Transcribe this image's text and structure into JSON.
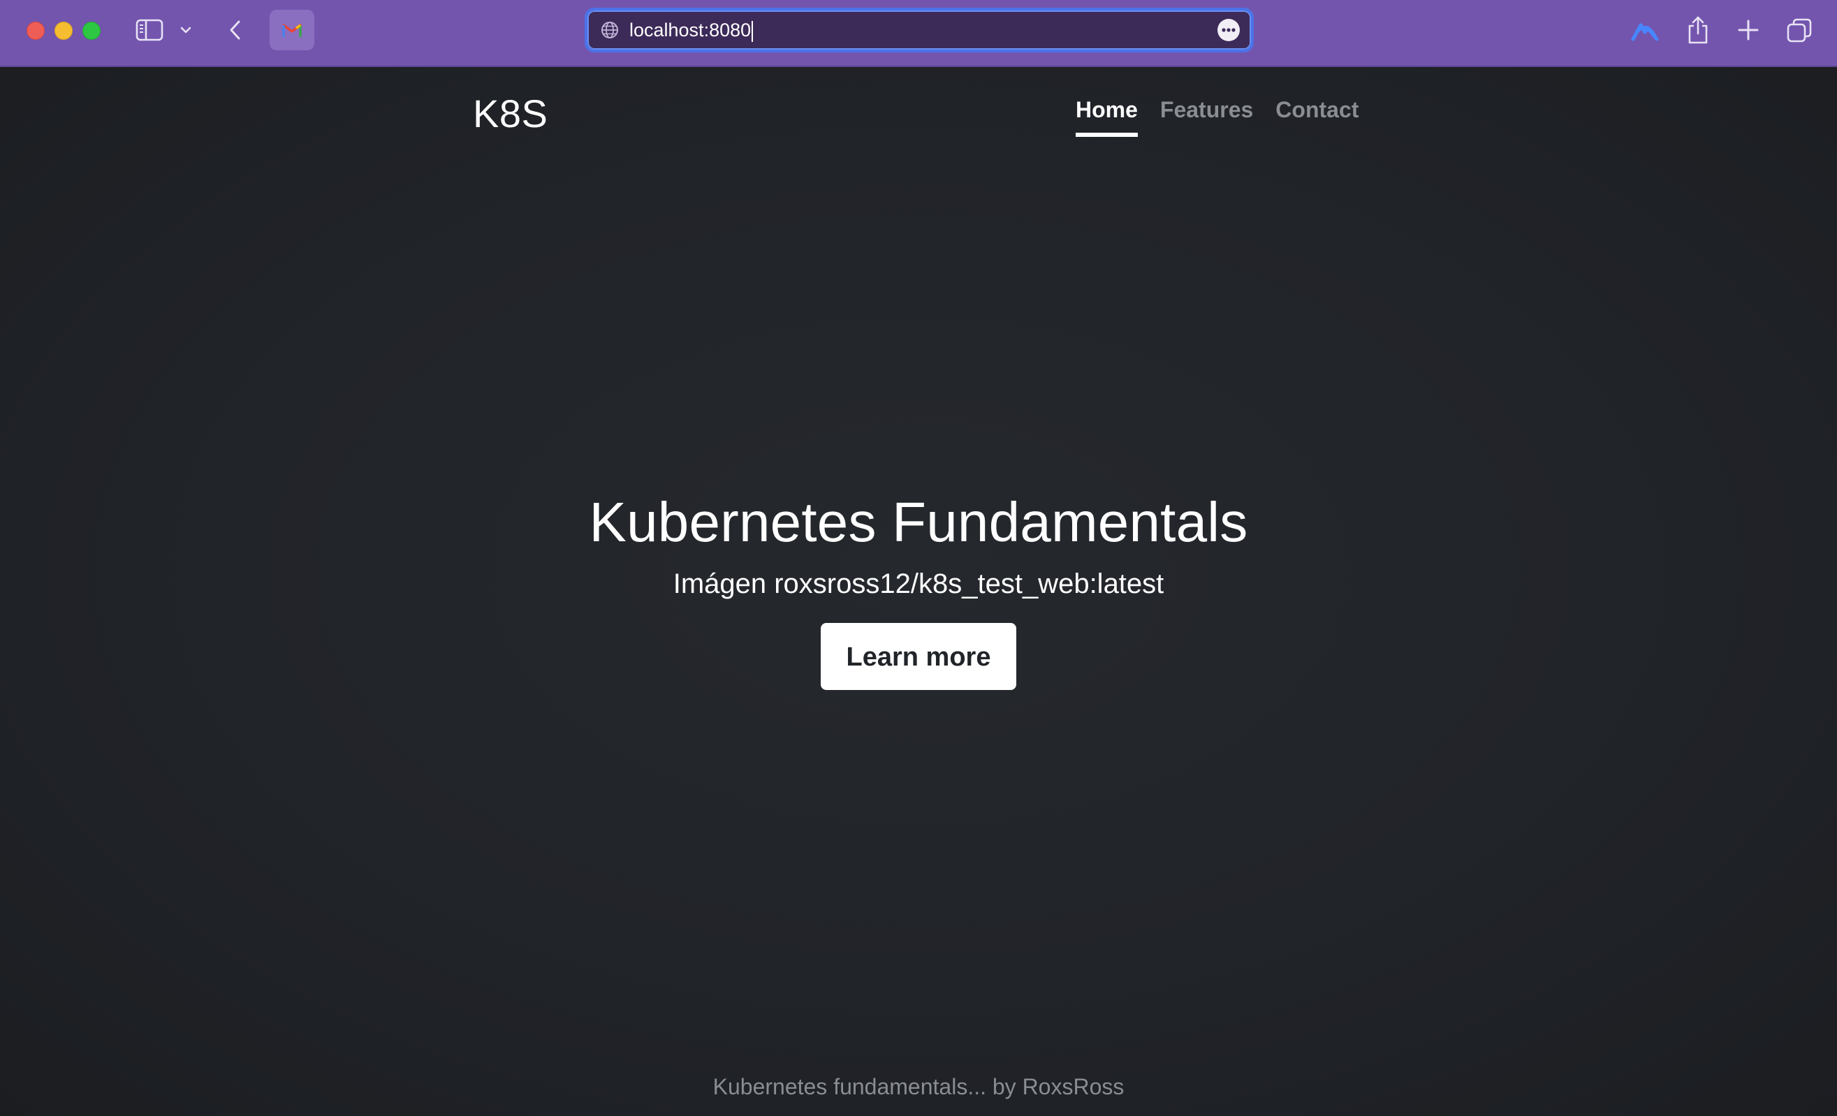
{
  "browser": {
    "url": "localhost:8080",
    "accent_color": "#7355ae",
    "icons": {
      "sidebar": "sidebar-icon",
      "sidebar_menu": "chevron-down-icon",
      "back": "chevron-left-icon",
      "favicon": "gmail-icon",
      "site": "globe-icon",
      "more": "ellipsis-icon",
      "vpn": "nordvpn-icon",
      "share": "share-icon",
      "new_tab": "plus-icon",
      "tabs": "tab-overview-icon"
    }
  },
  "site": {
    "brand": "K8S",
    "nav": [
      {
        "label": "Home",
        "active": true
      },
      {
        "label": "Features",
        "active": false
      },
      {
        "label": "Contact",
        "active": false
      }
    ],
    "hero": {
      "title": "Kubernetes Fundamentals",
      "subtitle": "Imágen roxsross12/k8s_test_web:latest",
      "button_label": "Learn more"
    },
    "footer": "Kubernetes fundamentals... by RoxsRoss",
    "colors": {
      "background": "#212429",
      "text": "#ffffff",
      "muted": "#8a8d92"
    }
  }
}
